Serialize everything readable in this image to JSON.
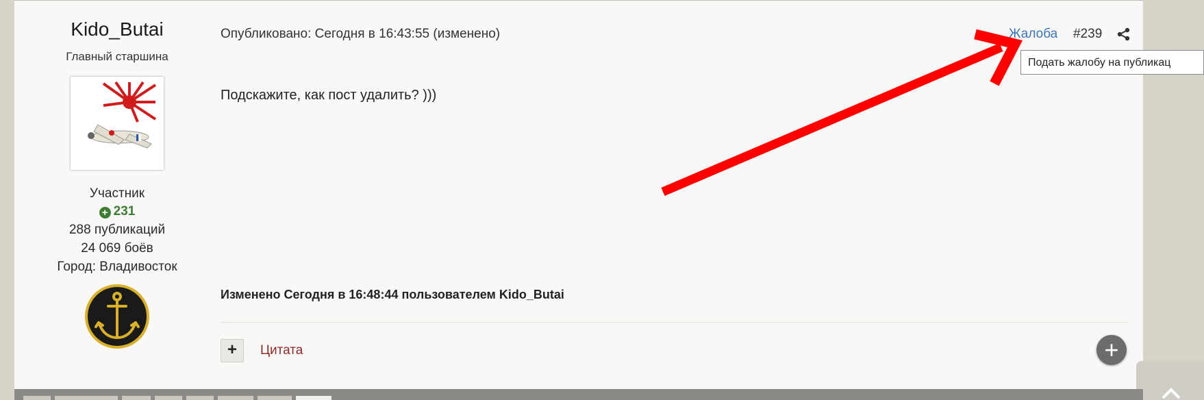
{
  "author": {
    "name": "Kido_Butai",
    "title": "Главный старшина",
    "group": "Участник",
    "reputation": "231",
    "posts": "288 публикаций",
    "battles": "24 069 боёв",
    "city": "Город: Владивосток"
  },
  "post": {
    "meta": "Опубликовано: Сегодня в 16:43:55 (изменено)",
    "report_label": "Жалоба",
    "number": "#239",
    "tooltip": "Подать жалобу на публикац",
    "content": "Подскажите, как пост удалить? )))",
    "edited": "Изменено Сегодня в 16:48:44 пользователем Kido_Butai",
    "multiquote_label": "+",
    "quote_label": "Цитата",
    "add_label": "+"
  },
  "colors": {
    "arrow": "#ff0000",
    "link": "#3a76b8",
    "quote": "#8a2b2b",
    "reputation": "#3f7c36"
  }
}
